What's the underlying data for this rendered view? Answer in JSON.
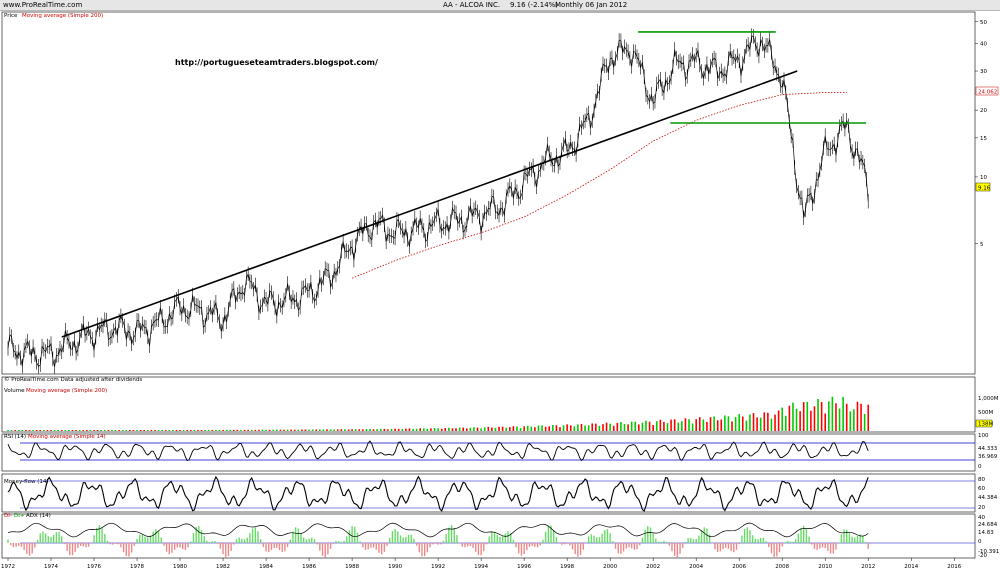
{
  "header": {
    "site": "www.ProRealTime.com",
    "instrument": "AA - ALCOA INC.",
    "last": "9.16 (-2.14%)",
    "period": "Monthly  06 Jan 2012"
  },
  "panels": {
    "price": {
      "label": "Price",
      "ma_label": "Moving average (Simple 200)",
      "url": "http://portugueseteamtraders.blogspot.com/",
      "footer": "© ProRealTime.com  Data adjusted after dividends",
      "ma_value": "24.062",
      "last_value": "9.16"
    },
    "volume": {
      "label": "Volume",
      "ma_label": "Moving average (Simple 200)",
      "last_value": "138M"
    },
    "rsi": {
      "label": "RSI (14)",
      "ma_label": "Moving average (Simple 14)",
      "values": [
        "44.333",
        "36.969"
      ]
    },
    "mfi": {
      "label": "Money-flow (14)",
      "values": [
        "44.384"
      ]
    },
    "dmi": {
      "label_di_minus": "DI-",
      "label_di_plus": "DI+",
      "label_adx": "ADX (14)",
      "values": [
        "24.684",
        "14.83",
        "-10.391"
      ]
    }
  },
  "colors": {
    "price_line": "#000000",
    "ma": "#cc0000",
    "trend": "#000000",
    "resistance": "#009900",
    "volume_up": "#00cc00",
    "volume_down": "#ff0000",
    "rsi_band": "#0000cc",
    "di_plus_fill": "#66dd66",
    "di_minus_fill": "#ee8888",
    "adx": "#000000",
    "ma_badge": "#ffffff",
    "last_badge": "#ffff00"
  },
  "chart_data": {
    "type": "line",
    "title": "AA - ALCOA INC. Monthly",
    "x_axis_years": [
      "1972",
      "1974",
      "1976",
      "1978",
      "1980",
      "1982",
      "1984",
      "1986",
      "1988",
      "1990",
      "1992",
      "1994",
      "1996",
      "1998",
      "2000",
      "2002",
      "2004",
      "2006",
      "2008",
      "2010",
      "2012",
      "2014",
      "2016"
    ],
    "y_axis_price_ticks": [
      5,
      10,
      15,
      20,
      30,
      40,
      50
    ],
    "y_scale": "log",
    "price_series": {
      "name": "Price",
      "x": [
        1972,
        1973,
        1974,
        1975,
        1976,
        1977,
        1978,
        1979,
        1980,
        1981,
        1982,
        1983,
        1984,
        1985,
        1986,
        1987,
        1988,
        1989,
        1990,
        1991,
        1992,
        1993,
        1994,
        1995,
        1996,
        1997,
        1998,
        1999,
        2000,
        2001,
        2002,
        2003,
        2004,
        2005,
        2006,
        2007,
        2008,
        2009,
        2010,
        2011,
        2012
      ],
      "y": [
        1.7,
        1.6,
        1.6,
        1.8,
        2.0,
        2.1,
        2.0,
        2.2,
        2.6,
        2.5,
        2.3,
        3.4,
        2.7,
        2.8,
        3.0,
        3.6,
        5.0,
        6.2,
        5.6,
        5.8,
        6.2,
        6.4,
        6.8,
        7.5,
        9.5,
        11.8,
        13.0,
        18.0,
        35.0,
        38.0,
        22.0,
        32.0,
        33.0,
        30.0,
        34.0,
        42.0,
        28.0,
        6.5,
        13.0,
        17.0,
        9.16
      ]
    },
    "ma_series": {
      "name": "Moving average (Simple 200)",
      "x": [
        1988,
        1990,
        1992,
        1994,
        1996,
        1998,
        2000,
        2002,
        2004,
        2006,
        2008,
        2010,
        2011
      ],
      "y": [
        3.5,
        4.2,
        4.9,
        5.6,
        6.6,
        8.3,
        10.8,
        14.5,
        18.0,
        21.0,
        23.5,
        24.0,
        24.062
      ]
    },
    "trendline": {
      "from": [
        1974.5,
        1.9
      ],
      "to": [
        2008.7,
        30.0
      ]
    },
    "resistance_lines": [
      {
        "from": [
          2001.3,
          45.0
        ],
        "to": [
          2007.7,
          45.0
        ]
      },
      {
        "from": [
          2002.8,
          17.5
        ],
        "to": [
          2011.9,
          17.5
        ]
      }
    ],
    "volume_ticks": [
      "1,000M",
      "500M"
    ],
    "rsi_ticks": [
      100,
      50,
      0
    ],
    "mfi_ticks": [
      80,
      60,
      40,
      20
    ],
    "dmi_ticks": [
      40,
      20,
      0,
      -20
    ]
  }
}
